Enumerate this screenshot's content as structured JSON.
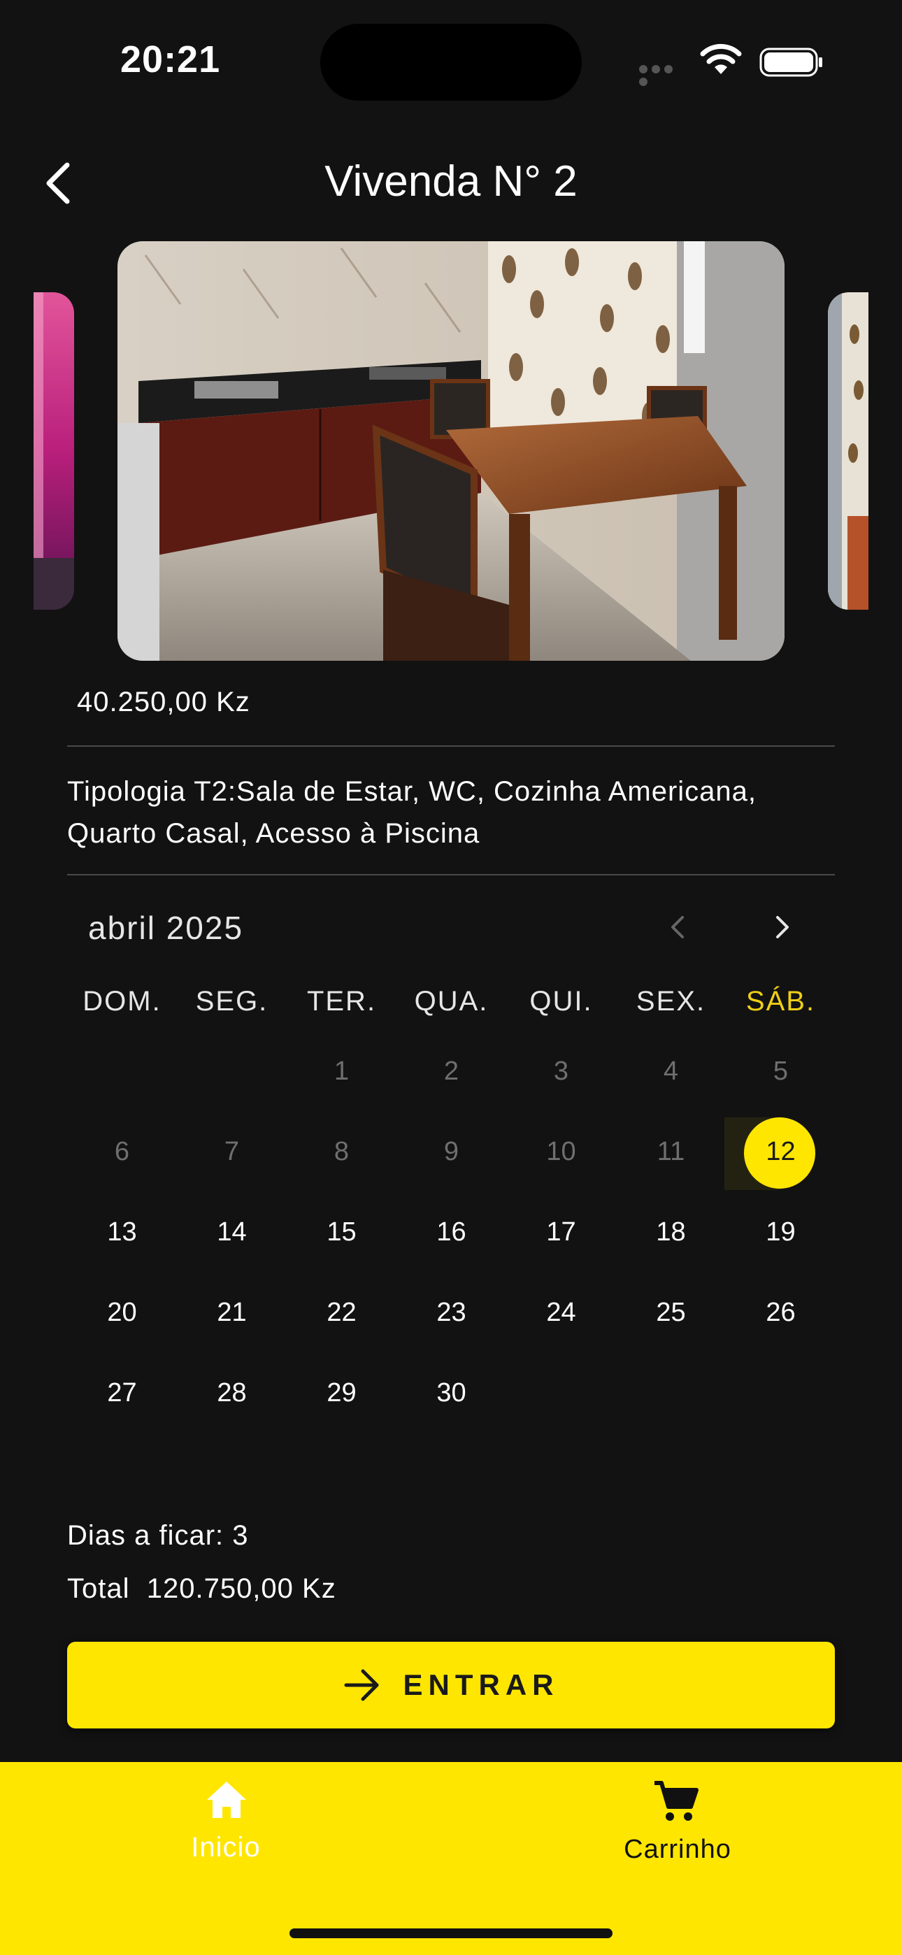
{
  "status_bar": {
    "time": "20:21"
  },
  "header": {
    "title": "Vivenda N° 2"
  },
  "listing": {
    "price": "40.250,00 Kz",
    "description": "Tipologia T2:Sala de Estar, WC, Cozinha Americana, Quarto Casal, Acesso à Piscina"
  },
  "calendar": {
    "month_label": "abril 2025",
    "weekdays": [
      "DOM.",
      "SEG.",
      "TER.",
      "QUA.",
      "QUI.",
      "SEX.",
      "SÁB."
    ],
    "weeks": [
      [
        "",
        "",
        "1",
        "2",
        "3",
        "4",
        "5"
      ],
      [
        "6",
        "7",
        "8",
        "9",
        "10",
        "11",
        "12"
      ],
      [
        "13",
        "14",
        "15",
        "16",
        "17",
        "18",
        "19"
      ],
      [
        "20",
        "21",
        "22",
        "23",
        "24",
        "25",
        "26"
      ],
      [
        "27",
        "28",
        "29",
        "30",
        "",
        "",
        ""
      ]
    ],
    "selected_day": "12",
    "accent_color": "#ffe600"
  },
  "summary": {
    "days_label": "Dias a ficar: 3",
    "total_label": "Total  120.750,00 Kz"
  },
  "actions": {
    "enter_label": "ENTRAR"
  },
  "bottom_nav": {
    "home_label": "Inicio",
    "cart_label": "Carrinho"
  }
}
